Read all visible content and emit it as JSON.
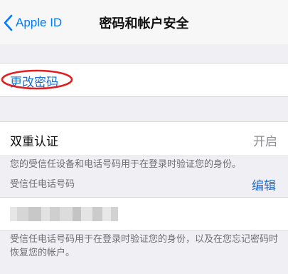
{
  "nav": {
    "back_label": "Apple ID",
    "title": "密码和帐户安全"
  },
  "change_password": {
    "label": "更改密码",
    "annotation_color": "#e02020"
  },
  "two_factor": {
    "label": "双重认证",
    "status": "开启",
    "note": "您的受信任设备和电话号码用于在登录时验证您的身份。"
  },
  "trusted_phone": {
    "header": "受信任电话号码",
    "edit_label": "编辑",
    "note": "受信任电话号码用于在登录时验证您的身份，以及在您忘记密码时恢复您的帐户。"
  },
  "colors": {
    "accent": "#007aff",
    "background": "#efeff4"
  }
}
